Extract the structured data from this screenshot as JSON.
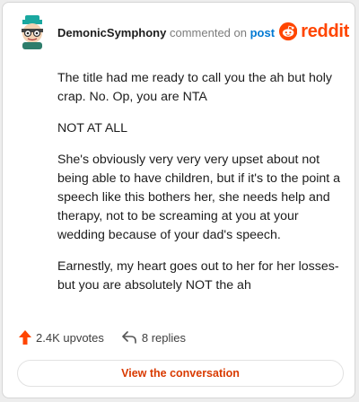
{
  "comment": {
    "username": "DemonicSymphony",
    "action_text": "commented on",
    "post_link_text": "post",
    "paragraphs": [
      "The title had me ready to call you the ah but holy crap. No. Op, you are NTA",
      "NOT AT ALL",
      "She's obviously very very very upset about not being able to have children, but if it's to the point a speech like this bothers her, she needs help and therapy, not to be screaming at you at your wedding because of your dad's speech.",
      "Earnestly, my heart goes out to her for her losses- but you are absolutely NOT the ah"
    ]
  },
  "brand": {
    "name": "reddit",
    "color": "#ff4500"
  },
  "footer": {
    "upvotes": "2.4K upvotes",
    "replies": "8 replies",
    "upvote_icon": "upvote-arrow-icon",
    "reply_icon": "reply-arrow-icon"
  },
  "cta": {
    "label": "View the conversation",
    "color": "#d93a00"
  }
}
